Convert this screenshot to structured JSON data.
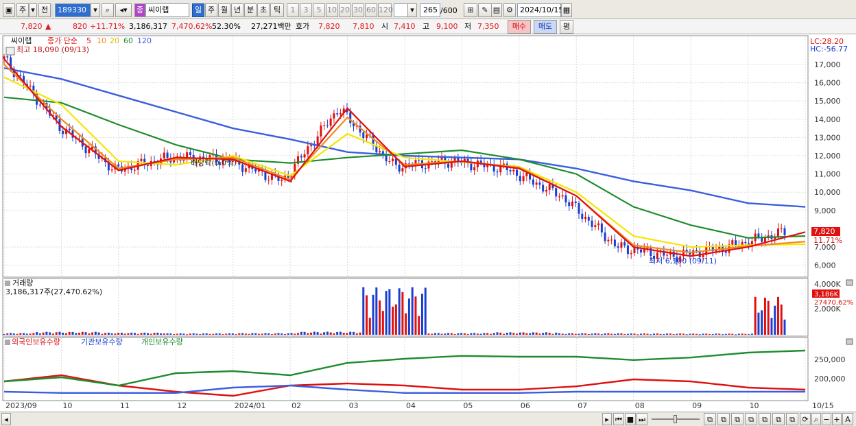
{
  "toolbar": {
    "period_type": "주",
    "market": "전",
    "code": "189330",
    "name_badge": "종",
    "stock_name": "씨이랩",
    "tabs": [
      "일",
      "주",
      "월",
      "년",
      "분",
      "초",
      "틱"
    ],
    "intervals": [
      "1",
      "3",
      "5",
      "10",
      "20",
      "30",
      "60",
      "120"
    ],
    "count": "265",
    "count_total": "/600",
    "date": "2024/10/15"
  },
  "quote": {
    "price": "7,820",
    "change_arrow": "▲",
    "change": "820",
    "change_pct": "+11.71%",
    "volume": "3,186,317",
    "volume_ratio": "7,470.62%",
    "turnover": "52.30%",
    "amount": "27,271백만",
    "bid_label": "호가",
    "ask_price": "7,820",
    "bid_price": "7,810",
    "open_label": "시",
    "open": "7,410",
    "high_label": "고",
    "high": "9,100",
    "low_label": "저",
    "low": "7,350",
    "buy_button": "매수",
    "sell_button": "매도",
    "eval_button": "평"
  },
  "price_panel": {
    "title": "씨이랩",
    "ma_label": "종가 단순",
    "ma_periods": [
      "5",
      "10",
      "20",
      "60",
      "120"
    ],
    "max_label": "최고 18,090 (09/13)",
    "min_label": "최저 6,100 (09/11)",
    "dividend_label": "배당락(0.0%)",
    "lc": "LC:28.20",
    "hc": "HC:-56.77",
    "current_tag": "7,820",
    "change_tag": "11.71%",
    "y_ticks": [
      "17,000",
      "16,000",
      "15,000",
      "14,000",
      "13,000",
      "12,000",
      "11,000",
      "10,000",
      "9,000",
      "7,000",
      "6,000"
    ]
  },
  "volume_panel": {
    "title": "거래량",
    "value": "3,186,317주(27,470.62%)",
    "y_ticks": [
      "4,000K",
      "2,000K"
    ],
    "current_tag": "3,186K",
    "pct_tag": "27470.62%"
  },
  "holder_panel": {
    "legend": [
      "외국인보유수량",
      "기관보유수량",
      "개인보유수량"
    ],
    "y_ticks": [
      "250,000",
      "200,000"
    ]
  },
  "x_axis": [
    "2023/09",
    "10",
    "11",
    "12",
    "2024/01",
    "02",
    "03",
    "04",
    "05",
    "06",
    "07",
    "08",
    "09",
    "10",
    "10/15"
  ],
  "colors": {
    "ma5": "#e01010",
    "ma10": "#f08a1c",
    "ma20": "#f4e600",
    "ma60": "#1e8c2e",
    "ma120": "#3a5ee0",
    "up": "#e01010",
    "down": "#1a3fd0"
  },
  "chart_data": {
    "type": "line",
    "x": [
      "2023/09",
      "10",
      "11",
      "12",
      "2024/01",
      "02",
      "03",
      "04",
      "05",
      "06",
      "07",
      "08",
      "09",
      "10",
      "10/15"
    ],
    "series": [
      {
        "name": "5",
        "values": [
          17300,
          13600,
          11200,
          11900,
          11800,
          10600,
          14600,
          11400,
          11700,
          11300,
          9800,
          7000,
          6500,
          7000,
          7820
        ]
      },
      {
        "name": "10",
        "values": [
          17000,
          14000,
          11300,
          11800,
          11900,
          10700,
          14100,
          11500,
          11700,
          11350,
          9800,
          7100,
          6700,
          7050,
          7300
        ]
      },
      {
        "name": "20",
        "values": [
          16300,
          14800,
          11700,
          11500,
          12000,
          10900,
          13200,
          11900,
          11650,
          11400,
          10000,
          7600,
          7000,
          7100,
          7150
        ]
      },
      {
        "name": "60",
        "values": [
          15200,
          14900,
          13700,
          12600,
          11800,
          11600,
          11900,
          12100,
          12300,
          11800,
          11000,
          9200,
          8200,
          7500,
          7600
        ]
      },
      {
        "name": "120",
        "values": [
          16800,
          16200,
          15300,
          14400,
          13500,
          12900,
          12200,
          12000,
          11900,
          11800,
          11300,
          10600,
          10100,
          9400,
          9200
        ]
      }
    ],
    "ylim": [
      5500,
      18500
    ],
    "volume_values": [
      150,
      250,
      180,
      120,
      140,
      260,
      4000,
      150,
      210,
      130,
      110,
      100,
      3186
    ],
    "holder_series": [
      {
        "name": "외국인보유수량",
        "values": [
          200000,
          215000,
          190000,
          175000,
          165000,
          190000,
          195000,
          190000,
          180000,
          180000,
          188000,
          205000,
          200000,
          185000,
          180000
        ]
      },
      {
        "name": "기관보유수량",
        "values": [
          175000,
          172000,
          172000,
          172000,
          185000,
          190000,
          180000,
          172000,
          172000,
          172000,
          175000,
          175000,
          175000,
          175000,
          175000
        ]
      },
      {
        "name": "개인보유수량",
        "values": [
          200000,
          210000,
          190000,
          220000,
          225000,
          215000,
          245000,
          255000,
          262000,
          260000,
          260000,
          252000,
          258000,
          270000,
          275000
        ]
      }
    ]
  }
}
